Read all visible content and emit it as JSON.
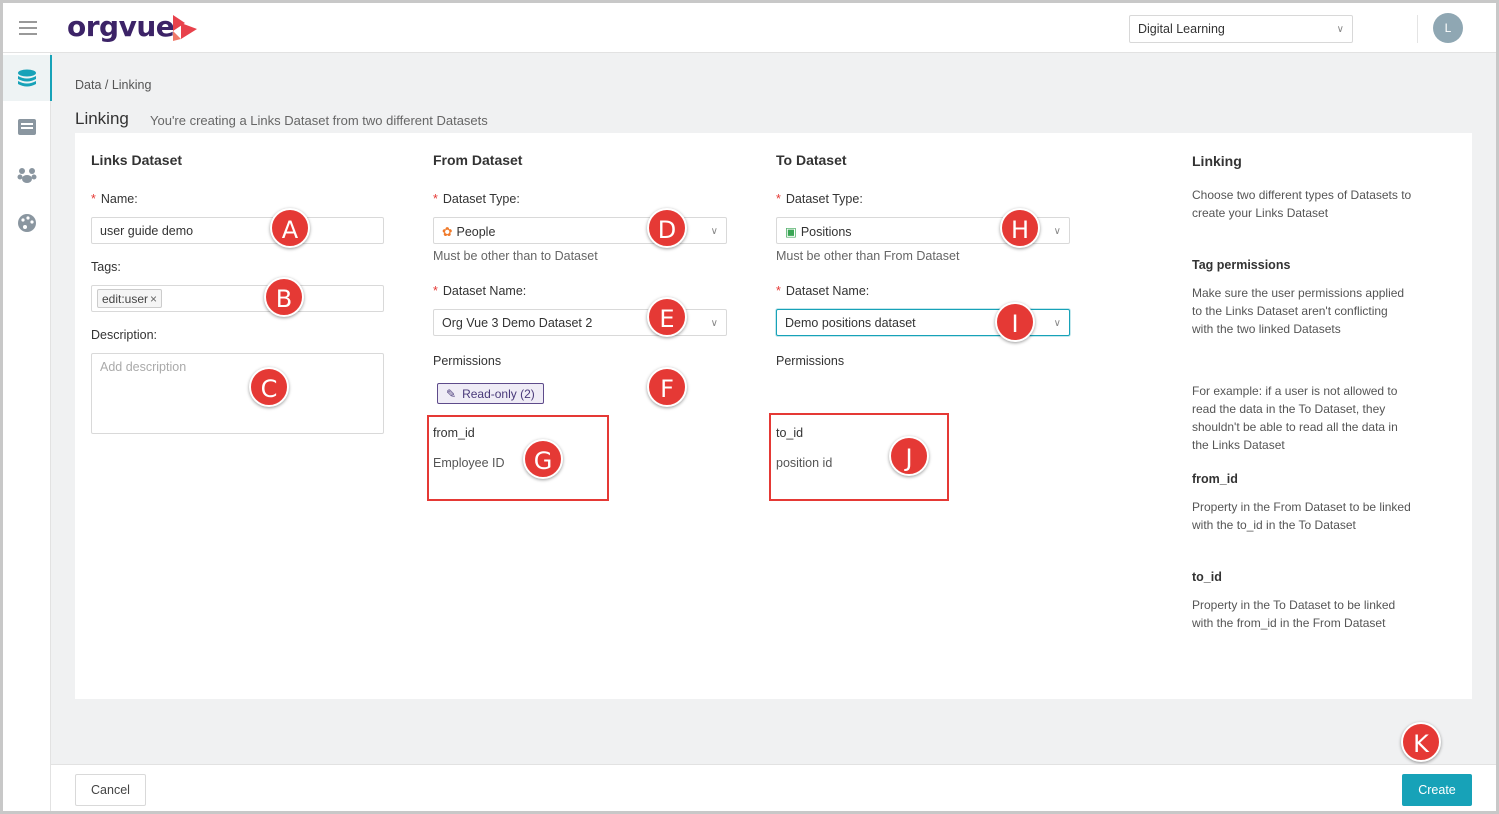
{
  "app": {
    "logo_text": "orgvue",
    "brand_color": "#3c2367",
    "accent_color": "#17a2b8"
  },
  "header": {
    "dataset_select": "Digital Learning",
    "avatar_initial": "L"
  },
  "breadcrumb": {
    "text": "Data / Linking"
  },
  "page": {
    "title": "Linking",
    "subtitle": "You're creating a Links Dataset from two different Datasets"
  },
  "links_dataset": {
    "title": "Links Dataset",
    "name_label": "Name",
    "name_value": "user guide demo",
    "tags_label": "Tags",
    "tag": "edit:user",
    "tag_remove": "×",
    "description_label": "Description",
    "description_placeholder": "Add description"
  },
  "from_dataset": {
    "title": "From Dataset",
    "type_label": "Dataset Type",
    "type_value": "People",
    "type_hint": "Must be other than to Dataset",
    "name_label": "Dataset Name",
    "name_value": "Org Vue 3 Demo Dataset 2",
    "permissions_label": "Permissions",
    "permissions_badge": "Read-only (2)",
    "field_key": "from_id",
    "field_value": "Employee ID"
  },
  "to_dataset": {
    "title": "To Dataset",
    "type_label": "Dataset Type",
    "type_value": "Positions",
    "type_hint": "Must be other than From Dataset",
    "name_label": "Dataset Name",
    "name_value": "Demo positions dataset",
    "permissions_label": "Permissions",
    "field_key": "to_id",
    "field_value": "position id"
  },
  "help": {
    "title": "Linking",
    "intro": "Choose two different types of Datasets to create your Links Dataset",
    "tag_perm_heading": "Tag permissions",
    "tag_perm_text": "Make sure the user permissions applied to the Links Dataset aren't conflicting with the two linked Datasets",
    "example_text": "For example: if a user is not allowed to read the data in the To Dataset, they shouldn't be able to read all the data in the Links Dataset",
    "from_id_heading": "from_id",
    "from_id_text": "Property in the From Dataset to be linked with the to_id in the To Dataset",
    "to_id_heading": "to_id",
    "to_id_text": "Property in the To Dataset to be linked with the from_id in the From Dataset"
  },
  "markers": [
    "A",
    "B",
    "C",
    "D",
    "E",
    "F",
    "G",
    "H",
    "I",
    "J",
    "K"
  ],
  "footer": {
    "cancel": "Cancel",
    "create": "Create"
  }
}
